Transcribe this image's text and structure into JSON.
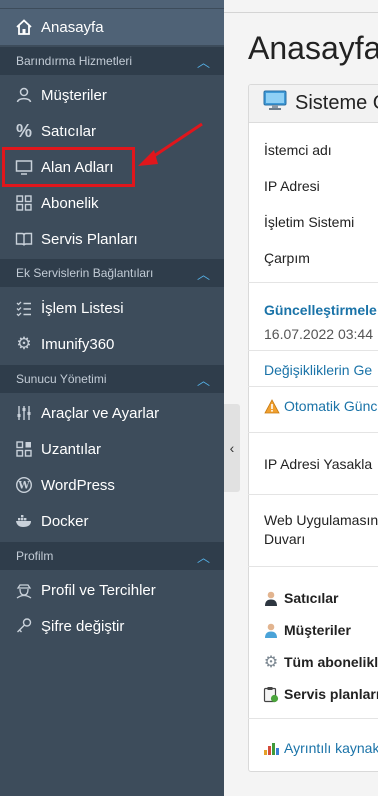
{
  "sidebar": {
    "home": "Anasayfa",
    "sections": [
      {
        "title": "Barındırma Hizmetleri",
        "items": [
          "Müşteriler",
          "Satıcılar",
          "Alan Adları",
          "Abonelik",
          "Servis Planları"
        ]
      },
      {
        "title": "Ek Servislerin Bağlantıları",
        "items": [
          "İşlem Listesi",
          "Imunify360"
        ]
      },
      {
        "title": "Sunucu Yönetimi",
        "items": [
          "Araçlar ve Ayarlar",
          "Uzantılar",
          "WordPress",
          "Docker"
        ]
      },
      {
        "title": "Profilm",
        "items": [
          "Profil ve Tercihler",
          "Şifre değiştir"
        ]
      }
    ]
  },
  "main": {
    "page_title": "Anasayfa",
    "card_title": "Sisteme G",
    "rows": [
      "İstemci adı",
      "IP Adresi",
      "İşletim Sistemi",
      "Çarpım"
    ],
    "updates_label": "Güncelleştirmele",
    "updates_date": "16.07.2022 03:44",
    "changes_link": "Değişikliklerin Ge",
    "auto_update": "Otomatik Günc",
    "ip_ban": "IP Adresi Yasakla",
    "waf_line1": "Web Uygulamasın",
    "waf_line2": "Duvarı",
    "stats": [
      "Satıcılar",
      "Müşteriler",
      "Tüm abonelikl",
      "Servis planları"
    ],
    "details_link": "Ayrıntılı kaynak"
  },
  "colors": {
    "sidebar": "#3d4c5b",
    "section_header": "#2f3d4b",
    "active": "#4f6276",
    "accent": "#55b0e6",
    "link": "#1a73a8",
    "annotation": "#e0161c"
  }
}
